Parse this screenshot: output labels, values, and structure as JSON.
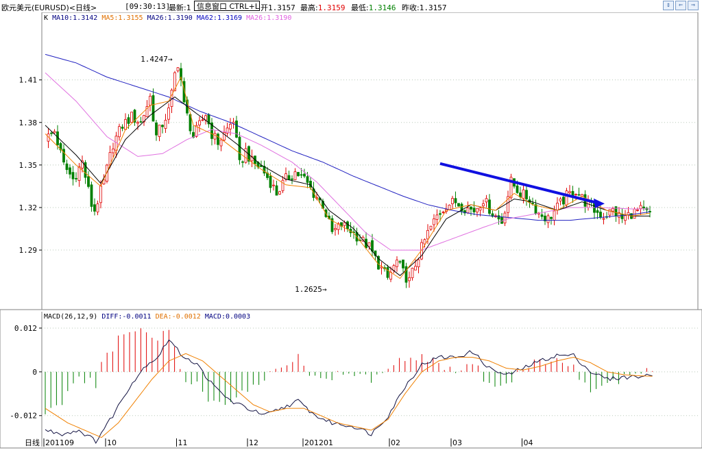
{
  "header": {
    "symbol": "欧元美元(EURUSD)<日线>",
    "time": "[09:30:13]",
    "latest_label": "最新:1",
    "popup": "信息窗口 CTRL+L",
    "open_label": "开",
    "open_value": "1.3157",
    "high_label": "最高:",
    "high_value": "1.3159",
    "low_label": "最低:",
    "low_value": "1.3146",
    "prev_label": "昨收:",
    "prev_value": "1.3157"
  },
  "window_buttons": [
    "restore-icon",
    "back-icon",
    "forward-icon"
  ],
  "colors": {
    "up": "#e00000",
    "down": "#008000",
    "ma5": "#f08000",
    "ma10": "#000000",
    "ma26": "#e070e0",
    "ma62": "#2020c0",
    "trend_arrow": "#1010e0",
    "grid": "#b8c8b8"
  },
  "main_legend": {
    "prefix": "K",
    "ma10": "MA10:1.3142",
    "ma5": "MA5:1.3155",
    "ma26": "MA26:1.3190",
    "ma62": "MA62:1.3169",
    "ma26b": "MA26:1.3190"
  },
  "macd_legend": {
    "params": "MACD(26,12,9)",
    "diff": "DIFF:-0.0011",
    "dea": "DEA:-0.0012",
    "macd": "MACD:0.0003"
  },
  "chart_data": {
    "type": "candlestick",
    "price_axis": {
      "ticks": [
        "1.41",
        "1.38",
        "1.35",
        "1.32",
        "1.29"
      ],
      "ylim": [
        1.248,
        1.448
      ]
    },
    "macd_axis": {
      "ticks": [
        "0.012",
        "0",
        "-0.012"
      ],
      "ylim": [
        -0.0205,
        0.0165
      ]
    },
    "x_labels": [
      {
        "label": "日线",
        "i": -3
      },
      {
        "label": "201109",
        "i": 0
      },
      {
        "label": "10",
        "i": 20
      },
      {
        "label": "11",
        "i": 43
      },
      {
        "label": "12",
        "i": 66
      },
      {
        "label": "201201",
        "i": 84
      },
      {
        "label": "02",
        "i": 112
      },
      {
        "label": "03",
        "i": 132
      },
      {
        "label": "04",
        "i": 155
      }
    ],
    "annotations": [
      {
        "text": "1.4247",
        "i": 43,
        "value": 1.4247
      },
      {
        "text": "1.2625",
        "i": 93,
        "value": 1.2625
      }
    ],
    "trend_arrow": {
      "from": {
        "i": 128,
        "value": 1.351
      },
      "to": {
        "i": 180,
        "value": 1.323
      }
    },
    "ohlc_keys": [
      1.37,
      1.364,
      1.375,
      1.355,
      1.345,
      1.338,
      1.352,
      1.36,
      1.348,
      1.322,
      1.313,
      1.336,
      1.341,
      1.35,
      1.368,
      1.374,
      1.37,
      1.378,
      1.372,
      1.38,
      1.384,
      1.392,
      1.397,
      1.404,
      1.393,
      1.372,
      1.365,
      1.382,
      1.381,
      1.369,
      1.356,
      1.365,
      1.36,
      1.35,
      1.345,
      1.348,
      1.34,
      1.327,
      1.335,
      1.344,
      1.338,
      1.325,
      1.316,
      1.322,
      1.304,
      1.3,
      1.31,
      1.307,
      1.296,
      1.285,
      1.3,
      1.292,
      1.279,
      1.28,
      1.27,
      1.282,
      1.275,
      1.283,
      1.279,
      1.284,
      1.295,
      1.306,
      1.315,
      1.315,
      1.324,
      1.32,
      1.314,
      1.322,
      1.318,
      1.328,
      1.316,
      1.308,
      1.322,
      1.338,
      1.332,
      1.327,
      1.322,
      1.316,
      1.31,
      1.318,
      1.325,
      1.327,
      1.32,
      1.316,
      1.327,
      1.335,
      1.331,
      1.322,
      1.318,
      1.314,
      1.32,
      1.312,
      1.316,
      1.32,
      1.316
    ],
    "close_pivots": [
      [
        0,
        1.368
      ],
      [
        3,
        1.374
      ],
      [
        6,
        1.35
      ],
      [
        9,
        1.34
      ],
      [
        12,
        1.352
      ],
      [
        15,
        1.322
      ],
      [
        16,
        1.318
      ],
      [
        19,
        1.338
      ],
      [
        22,
        1.365
      ],
      [
        25,
        1.378
      ],
      [
        28,
        1.384
      ],
      [
        31,
        1.38
      ],
      [
        33,
        1.392
      ],
      [
        34,
        1.398
      ],
      [
        35,
        1.384
      ],
      [
        36,
        1.37
      ],
      [
        40,
        1.388
      ],
      [
        41,
        1.4
      ],
      [
        42,
        1.414
      ],
      [
        43,
        1.422
      ],
      [
        44,
        1.41
      ],
      [
        45,
        1.392
      ],
      [
        48,
        1.37
      ],
      [
        50,
        1.378
      ],
      [
        52,
        1.386
      ],
      [
        54,
        1.372
      ],
      [
        56,
        1.366
      ],
      [
        58,
        1.372
      ],
      [
        61,
        1.382
      ],
      [
        63,
        1.35
      ],
      [
        65,
        1.36
      ],
      [
        67,
        1.352
      ],
      [
        70,
        1.348
      ],
      [
        73,
        1.338
      ],
      [
        75,
        1.33
      ],
      [
        78,
        1.34
      ],
      [
        81,
        1.345
      ],
      [
        84,
        1.34
      ],
      [
        87,
        1.33
      ],
      [
        90,
        1.322
      ],
      [
        93,
        1.302
      ],
      [
        96,
        1.308
      ],
      [
        99,
        1.304
      ],
      [
        102,
        1.298
      ],
      [
        105,
        1.292
      ],
      [
        108,
        1.28
      ],
      [
        111,
        1.27
      ],
      [
        114,
        1.282
      ],
      [
        116,
        1.274
      ],
      [
        118,
        1.268
      ],
      [
        121,
        1.286
      ],
      [
        124,
        1.302
      ],
      [
        127,
        1.314
      ],
      [
        130,
        1.322
      ],
      [
        133,
        1.324
      ],
      [
        136,
        1.32
      ],
      [
        139,
        1.318
      ],
      [
        142,
        1.326
      ],
      [
        145,
        1.316
      ],
      [
        148,
        1.31
      ],
      [
        151,
        1.338
      ],
      [
        154,
        1.33
      ],
      [
        157,
        1.326
      ],
      [
        160,
        1.316
      ],
      [
        163,
        1.312
      ],
      [
        166,
        1.32
      ],
      [
        169,
        1.328
      ],
      [
        172,
        1.332
      ],
      [
        175,
        1.324
      ],
      [
        178,
        1.318
      ],
      [
        181,
        1.314
      ],
      [
        184,
        1.318
      ],
      [
        187,
        1.312
      ],
      [
        190,
        1.316
      ],
      [
        193,
        1.318
      ],
      [
        196,
        1.315
      ]
    ],
    "ma_pivots": {
      "ma5": [
        [
          0,
          1.372
        ],
        [
          10,
          1.35
        ],
        [
          18,
          1.335
        ],
        [
          26,
          1.375
        ],
        [
          34,
          1.392
        ],
        [
          40,
          1.395
        ],
        [
          44,
          1.412
        ],
        [
          48,
          1.378
        ],
        [
          56,
          1.37
        ],
        [
          62,
          1.36
        ],
        [
          70,
          1.347
        ],
        [
          78,
          1.336
        ],
        [
          86,
          1.334
        ],
        [
          92,
          1.312
        ],
        [
          100,
          1.302
        ],
        [
          108,
          1.28
        ],
        [
          115,
          1.27
        ],
        [
          122,
          1.29
        ],
        [
          130,
          1.318
        ],
        [
          138,
          1.322
        ],
        [
          146,
          1.318
        ],
        [
          152,
          1.33
        ],
        [
          158,
          1.322
        ],
        [
          166,
          1.318
        ],
        [
          174,
          1.328
        ],
        [
          182,
          1.318
        ],
        [
          190,
          1.314
        ],
        [
          196,
          1.316
        ]
      ],
      "ma10": [
        [
          0,
          1.378
        ],
        [
          10,
          1.357
        ],
        [
          18,
          1.337
        ],
        [
          26,
          1.368
        ],
        [
          34,
          1.385
        ],
        [
          42,
          1.398
        ],
        [
          48,
          1.388
        ],
        [
          56,
          1.375
        ],
        [
          62,
          1.365
        ],
        [
          70,
          1.35
        ],
        [
          78,
          1.34
        ],
        [
          86,
          1.336
        ],
        [
          92,
          1.318
        ],
        [
          100,
          1.305
        ],
        [
          108,
          1.284
        ],
        [
          115,
          1.272
        ],
        [
          122,
          1.286
        ],
        [
          130,
          1.312
        ],
        [
          138,
          1.322
        ],
        [
          146,
          1.318
        ],
        [
          152,
          1.326
        ],
        [
          158,
          1.324
        ],
        [
          166,
          1.318
        ],
        [
          174,
          1.324
        ],
        [
          182,
          1.318
        ],
        [
          190,
          1.314
        ],
        [
          196,
          1.314
        ]
      ],
      "ma26": [
        [
          0,
          1.415
        ],
        [
          10,
          1.395
        ],
        [
          20,
          1.37
        ],
        [
          30,
          1.356
        ],
        [
          38,
          1.358
        ],
        [
          46,
          1.368
        ],
        [
          54,
          1.375
        ],
        [
          62,
          1.372
        ],
        [
          70,
          1.364
        ],
        [
          80,
          1.352
        ],
        [
          88,
          1.338
        ],
        [
          96,
          1.32
        ],
        [
          104,
          1.302
        ],
        [
          112,
          1.29
        ],
        [
          122,
          1.29
        ],
        [
          132,
          1.298
        ],
        [
          142,
          1.306
        ],
        [
          150,
          1.312
        ],
        [
          160,
          1.316
        ],
        [
          170,
          1.32
        ],
        [
          180,
          1.32
        ],
        [
          190,
          1.319
        ],
        [
          196,
          1.319
        ]
      ],
      "ma62": [
        [
          0,
          1.428
        ],
        [
          10,
          1.422
        ],
        [
          20,
          1.412
        ],
        [
          30,
          1.405
        ],
        [
          40,
          1.398
        ],
        [
          50,
          1.388
        ],
        [
          60,
          1.38
        ],
        [
          70,
          1.37
        ],
        [
          80,
          1.36
        ],
        [
          90,
          1.352
        ],
        [
          100,
          1.342
        ],
        [
          108,
          1.335
        ],
        [
          116,
          1.328
        ],
        [
          124,
          1.322
        ],
        [
          132,
          1.318
        ],
        [
          140,
          1.315
        ],
        [
          150,
          1.313
        ],
        [
          160,
          1.311
        ],
        [
          170,
          1.311
        ],
        [
          180,
          1.313
        ],
        [
          190,
          1.315
        ],
        [
          196,
          1.317
        ]
      ]
    },
    "macd_pivots": {
      "diff": [
        [
          0,
          -0.016
        ],
        [
          6,
          -0.017
        ],
        [
          12,
          -0.016
        ],
        [
          18,
          -0.019
        ],
        [
          24,
          -0.012
        ],
        [
          30,
          -0.004
        ],
        [
          36,
          0.002
        ],
        [
          40,
          0.004
        ],
        [
          44,
          0.009
        ],
        [
          48,
          0.005
        ],
        [
          54,
          0.002
        ],
        [
          60,
          -0.004
        ],
        [
          66,
          -0.008
        ],
        [
          72,
          -0.01
        ],
        [
          78,
          -0.012
        ],
        [
          84,
          -0.01
        ],
        [
          90,
          -0.008
        ],
        [
          96,
          -0.012
        ],
        [
          102,
          -0.014
        ],
        [
          110,
          -0.015
        ],
        [
          116,
          -0.017
        ],
        [
          122,
          -0.012
        ],
        [
          128,
          -0.004
        ],
        [
          134,
          0.002
        ],
        [
          140,
          0.004
        ],
        [
          146,
          0.004
        ],
        [
          152,
          0.0055
        ],
        [
          158,
          0.001
        ],
        [
          164,
          -0.001
        ],
        [
          170,
          0.001
        ],
        [
          176,
          0.003
        ],
        [
          182,
          0.0045
        ],
        [
          188,
          0.0045
        ],
        [
          194,
          0.0
        ],
        [
          200,
          -0.002
        ],
        [
          206,
          -0.0015
        ],
        [
          212,
          -0.0012
        ],
        [
          216,
          -0.0011
        ]
      ],
      "dea": [
        [
          0,
          -0.01
        ],
        [
          8,
          -0.014
        ],
        [
          14,
          -0.016
        ],
        [
          20,
          -0.018
        ],
        [
          26,
          -0.014
        ],
        [
          32,
          -0.008
        ],
        [
          38,
          -0.002
        ],
        [
          44,
          0.003
        ],
        [
          50,
          0.005
        ],
        [
          56,
          0.003
        ],
        [
          62,
          -0.001
        ],
        [
          68,
          -0.005
        ],
        [
          74,
          -0.009
        ],
        [
          80,
          -0.011
        ],
        [
          86,
          -0.01
        ],
        [
          92,
          -0.01
        ],
        [
          98,
          -0.012
        ],
        [
          104,
          -0.014
        ],
        [
          110,
          -0.015
        ],
        [
          116,
          -0.016
        ],
        [
          122,
          -0.013
        ],
        [
          128,
          -0.006
        ],
        [
          134,
          0.0
        ],
        [
          140,
          0.003
        ],
        [
          146,
          0.004
        ],
        [
          152,
          0.004
        ],
        [
          158,
          0.003
        ],
        [
          164,
          0.001
        ],
        [
          170,
          0.0005
        ],
        [
          176,
          0.0015
        ],
        [
          182,
          0.003
        ],
        [
          188,
          0.004
        ],
        [
          194,
          0.0025
        ],
        [
          200,
          0.0
        ],
        [
          206,
          -0.0008
        ],
        [
          212,
          -0.0011
        ],
        [
          216,
          -0.0012
        ]
      ]
    }
  }
}
